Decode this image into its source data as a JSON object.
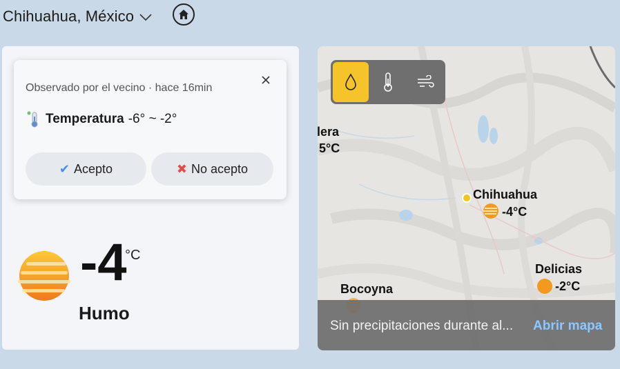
{
  "header": {
    "location": "Chihuahua, México"
  },
  "popup": {
    "observed": "Observado por el vecino · hace 16min",
    "temp_label": "Temperatura",
    "temp_range": "-6° ~ -2°",
    "accept_label": "Acepto",
    "reject_label": "No acepto"
  },
  "current": {
    "temperature": "-4",
    "unit": "°C",
    "condition": "Humo"
  },
  "map": {
    "places": [
      {
        "name": "lera",
        "temp": "5°C"
      },
      {
        "name": "Chihuahua",
        "temp": "-4°C"
      },
      {
        "name": "Delicias",
        "temp": "-2°C"
      },
      {
        "name": "Bocoyna",
        "temp": ""
      }
    ],
    "footer_text": "Sin precipitaciones durante al...",
    "footer_link": "Abrir mapa",
    "active_layer": "precipitation"
  },
  "colors": {
    "background": "#c9d9e8",
    "accent_yellow": "#f5c42a",
    "link_blue": "#8cc7ff",
    "sun_orange": "#f39a1e"
  },
  "icons": {
    "location_chevron": "chevron-down-icon",
    "home": "home-icon",
    "close": "close-icon",
    "thermometer": "thermometer-icon",
    "check": "check-icon",
    "cross": "cross-icon",
    "weather": "haze-sun-icon",
    "layer_precip": "water-drop-icon",
    "layer_temp": "thermometer-icon",
    "layer_wind": "wind-icon"
  }
}
